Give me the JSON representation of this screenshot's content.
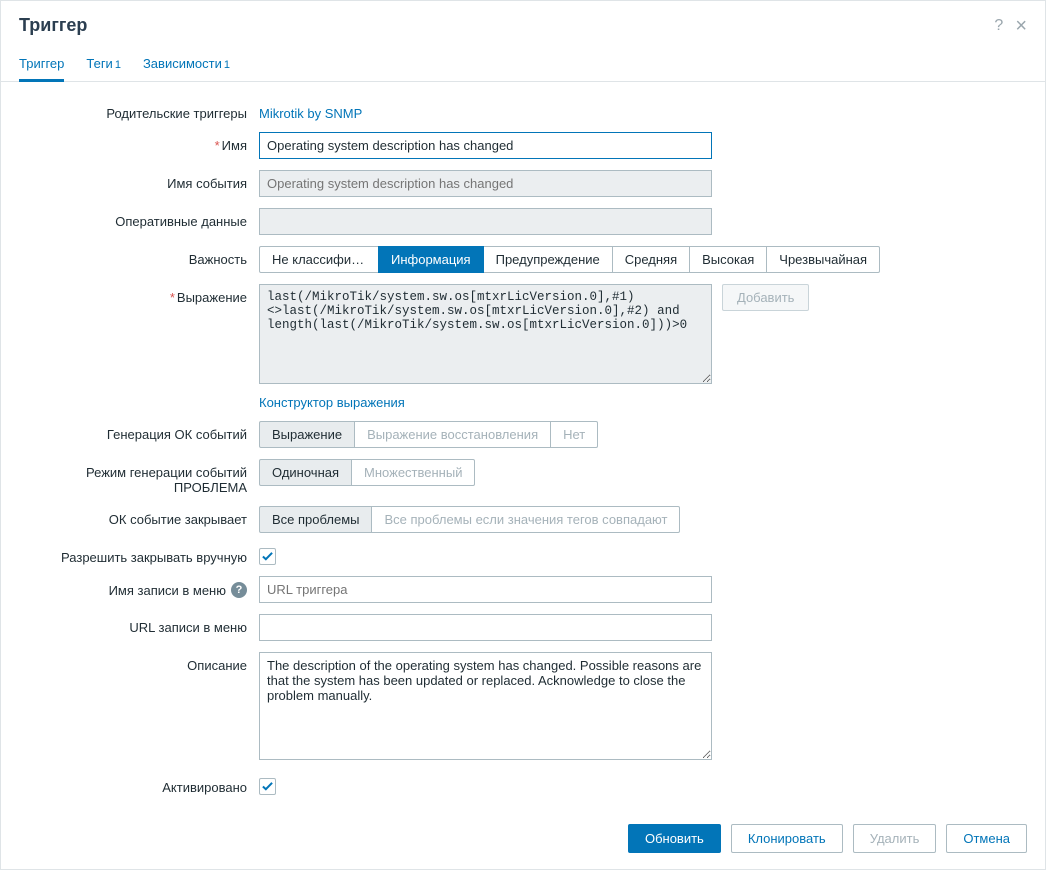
{
  "header": {
    "title": "Триггер"
  },
  "tabs": {
    "trigger": "Триггер",
    "tags": "Теги",
    "tags_count": "1",
    "deps": "Зависимости",
    "deps_count": "1"
  },
  "labels": {
    "parent": "Родительские триггеры",
    "name": "Имя",
    "event_name": "Имя события",
    "opdata": "Оперативные данные",
    "severity": "Важность",
    "expression": "Выражение",
    "expr_constructor": "Конструктор выражения",
    "ok_gen": "Генерация ОК событий",
    "problem_mode": "Режим генерации событий ПРОБЛЕМА",
    "ok_closes": "ОК событие закрывает",
    "manual_close": "Разрешить закрывать вручную",
    "menu_name": "Имя записи в меню",
    "menu_url": "URL записи в меню",
    "description": "Описание",
    "enabled": "Активировано"
  },
  "values": {
    "parent_link": "Mikrotik by SNMP",
    "name": "Operating system description has changed",
    "event_name_placeholder": "Operating system description has changed",
    "expression": "last(/MikroTik/system.sw.os[mtxrLicVersion.0],#1)<>last(/MikroTik/system.sw.os[mtxrLicVersion.0],#2) and length(last(/MikroTik/system.sw.os[mtxrLicVersion.0]))>0",
    "menu_name_placeholder": "URL триггера",
    "description": "The description of the operating system has changed. Possible reasons are that the system has been updated or replaced. Acknowledge to close the problem manually."
  },
  "severity": [
    "Не классифицир…",
    "Информация",
    "Предупреждение",
    "Средняя",
    "Высокая",
    "Чрезвычайная"
  ],
  "ok_gen": [
    "Выражение",
    "Выражение восстановления",
    "Нет"
  ],
  "problem_mode": [
    "Одиночная",
    "Множественный"
  ],
  "ok_closes": [
    "Все проблемы",
    "Все проблемы если значения тегов совпадают"
  ],
  "buttons": {
    "add": "Добавить",
    "update": "Обновить",
    "clone": "Клонировать",
    "delete": "Удалить",
    "cancel": "Отмена"
  }
}
